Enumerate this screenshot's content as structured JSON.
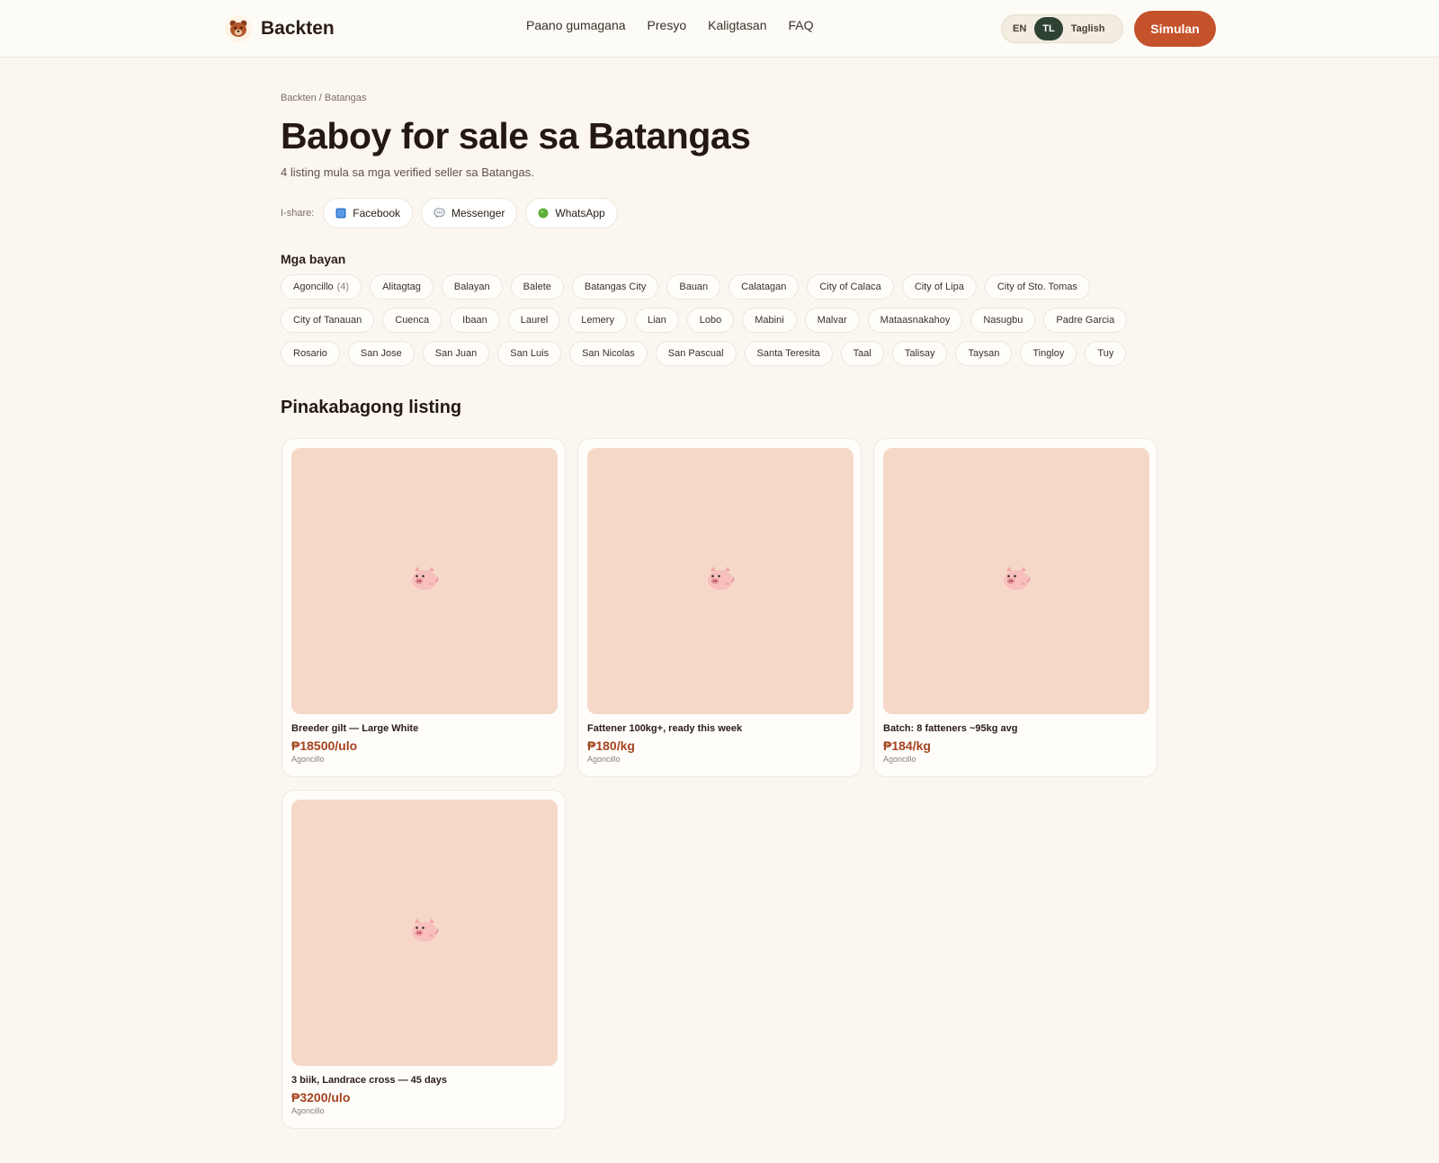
{
  "header": {
    "brand": "Backten",
    "nav": [
      "Paano gumagana",
      "Presyo",
      "Kaligtasan",
      "FAQ"
    ],
    "languages": [
      "EN",
      "TL",
      "Taglish"
    ],
    "active_language": "TL",
    "cta": "Simulan"
  },
  "breadcrumb": "Backten / Batangas",
  "title": "Baboy for sale sa Batangas",
  "subtitle": "4 listing mula sa mga verified seller sa Batangas.",
  "share": {
    "label": "I-share:",
    "buttons": [
      {
        "label": "Facebook",
        "icon": "facebook-icon"
      },
      {
        "label": "Messenger",
        "icon": "messenger-icon"
      },
      {
        "label": "WhatsApp",
        "icon": "whatsapp-icon"
      }
    ]
  },
  "towns_heading": "Mga bayan",
  "towns": [
    {
      "name": "Agoncillo",
      "count": "(4)"
    },
    {
      "name": "Alitagtag"
    },
    {
      "name": "Balayan"
    },
    {
      "name": "Balete"
    },
    {
      "name": "Batangas City"
    },
    {
      "name": "Bauan"
    },
    {
      "name": "Calatagan"
    },
    {
      "name": "City of Calaca"
    },
    {
      "name": "City of Lipa"
    },
    {
      "name": "City of Sto. Tomas"
    },
    {
      "name": "City of Tanauan"
    },
    {
      "name": "Cuenca"
    },
    {
      "name": "Ibaan"
    },
    {
      "name": "Laurel"
    },
    {
      "name": "Lemery"
    },
    {
      "name": "Lian"
    },
    {
      "name": "Lobo"
    },
    {
      "name": "Mabini"
    },
    {
      "name": "Malvar"
    },
    {
      "name": "Mataasnakahoy"
    },
    {
      "name": "Nasugbu"
    },
    {
      "name": "Padre Garcia"
    },
    {
      "name": "Rosario"
    },
    {
      "name": "San Jose"
    },
    {
      "name": "San Juan"
    },
    {
      "name": "San Luis"
    },
    {
      "name": "San Nicolas"
    },
    {
      "name": "San Pascual"
    },
    {
      "name": "Santa Teresita"
    },
    {
      "name": "Taal"
    },
    {
      "name": "Talisay"
    },
    {
      "name": "Taysan"
    },
    {
      "name": "Tingloy"
    },
    {
      "name": "Tuy"
    }
  ],
  "listings_heading": "Pinakabagong listing",
  "listings": [
    {
      "title": "Breeder gilt — Large White",
      "price": "₱18500/ulo",
      "town": "Agoncillo"
    },
    {
      "title": "Fattener 100kg+, ready this week",
      "price": "₱180/kg",
      "town": "Agoncillo"
    },
    {
      "title": "Batch: 8 fatteners ~95kg avg",
      "price": "₱184/kg",
      "town": "Agoncillo"
    },
    {
      "title": "3 biik, Landrace cross — 45 days",
      "price": "₱3200/ulo",
      "town": "Agoncillo"
    }
  ],
  "colors": {
    "accent": "#c4522b",
    "price": "#a44320",
    "active_lang": "#2d4232",
    "placeholder": "#f5d8c8"
  }
}
